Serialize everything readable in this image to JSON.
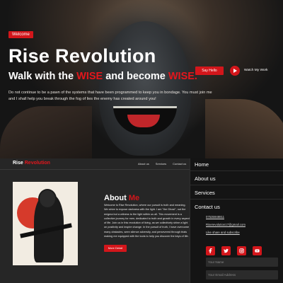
{
  "hero": {
    "badge": "Welcome",
    "title": "Rise Revolution",
    "tagline_part1": "Walk with the ",
    "tagline_wise1": "WISE",
    "tagline_part2": " and become ",
    "tagline_wise2": "WISE.",
    "description": "Do not continue to be a pawn of the systems that have been programmed to keep you in bondage. You must join me and I shall help you break through the fog of lies the enemy has created around you!",
    "say_hello_label": "Say Hello",
    "watch_label": "Watch My Work"
  },
  "nav": {
    "brand_part1": "Rise",
    "brand_part2": "Revolution",
    "links": [
      "",
      "About us",
      "Services",
      "Contact us"
    ]
  },
  "about": {
    "heading_part1": "About",
    "heading_part2": "Me",
    "body": "Welcome to Rise Revolution, where our pursuit is truth and meaning. We strive to expose darkness with the light. I am \"the Ghost\", not the enigma but a witness to the light within us all. This movement is a collective journey for men, dedicated to truth and growth in every aspect of life. Join us in this revolution of living, as we collectively shine a light on positivity and inspire change. In the pursuit of truth, I have overcome many obstacles, seen silence adversity, and persevered through trials making me equipped with the tools to help you discover the keys of life.",
    "button_label": "More Detail"
  },
  "menu": {
    "items": [
      "Home",
      "About us",
      "Services",
      "Contact us"
    ],
    "phone": "07535948811",
    "email": "Riserevolution17@gmail.com",
    "share": "Like share and subscribe",
    "socials": [
      "facebook-icon",
      "twitter-icon",
      "instagram-icon",
      "youtube-icon"
    ],
    "name_placeholder": "Your Name",
    "email_placeholder": "Your Email Address"
  },
  "colors": {
    "accent": "#d3161b",
    "panel": "#141414",
    "page": "#262626"
  }
}
